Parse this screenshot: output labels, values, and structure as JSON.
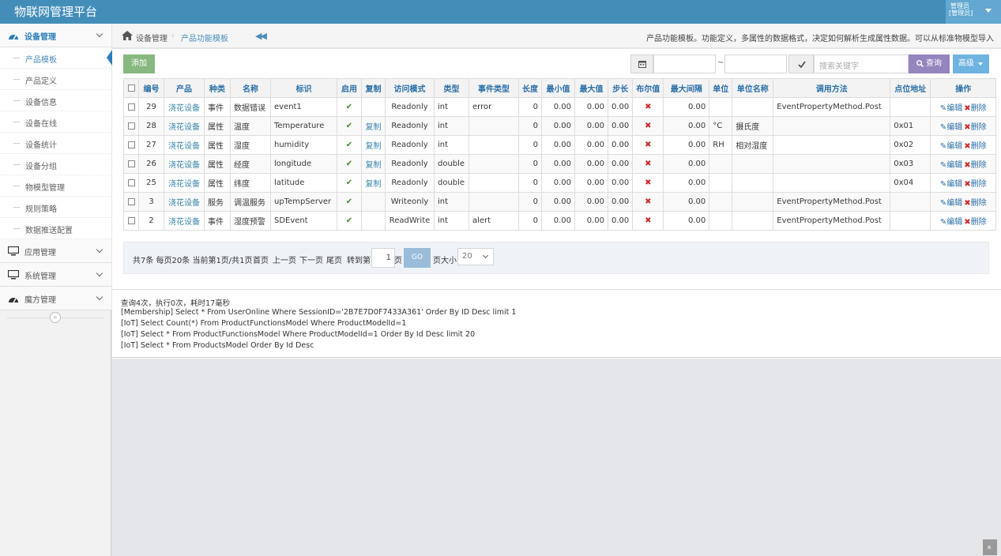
{
  "app": {
    "title": "物联网管理平台"
  },
  "user": {
    "line1": "管理员",
    "line2": "[管理员]"
  },
  "sidebar": {
    "groups": [
      {
        "label": "设备管理",
        "icon": "dashboard-icon"
      },
      {
        "label": "应用管理",
        "icon": "desktop-icon"
      },
      {
        "label": "系统管理",
        "icon": "desktop-icon"
      },
      {
        "label": "魔方管理",
        "icon": "dashboard-icon"
      }
    ],
    "subitems": [
      "产品模板",
      "产品定义",
      "设备信息",
      "设备在线",
      "设备统计",
      "设备分组",
      "物模型管理",
      "规则策略",
      "数据推送配置"
    ],
    "collapse": "«"
  },
  "breadcrumb": {
    "root": "设备管理",
    "sep": "›",
    "current": "产品功能模板",
    "back": "◀◀",
    "description": "产品功能模板。功能定义，多属性的数据格式，决定如何解析生成属性数据。可以从标准物模型导入"
  },
  "toolbar": {
    "add": "添加",
    "tilde": "~",
    "search_placeholder": "搜索关键字",
    "query": "查询",
    "advanced": "高级"
  },
  "table": {
    "headers": [
      "编号",
      "产品",
      "种类",
      "名称",
      "标识",
      "启用",
      "复制",
      "访问模式",
      "类型",
      "事件类型",
      "长度",
      "最小值",
      "最大值",
      "步长",
      "布尔值",
      "最大间隔",
      "单位",
      "单位名称",
      "调用方法",
      "点位地址",
      "操作"
    ],
    "rows": [
      {
        "id": "29",
        "product": "浇花设备",
        "kind": "事件",
        "name": "数据错误",
        "ident": "event1",
        "copy": "",
        "access": "Readonly",
        "type": "int",
        "event_type": "error",
        "length": "0",
        "min": "0.00",
        "max": "0.00",
        "step": "0.00",
        "interval": "0.00",
        "unit": "",
        "unit_name": "",
        "method": "EventPropertyMethod.Post",
        "addr": ""
      },
      {
        "id": "28",
        "product": "浇花设备",
        "kind": "属性",
        "name": "温度",
        "ident": "Temperature",
        "copy": "复制",
        "access": "Readonly",
        "type": "int",
        "event_type": "",
        "length": "0",
        "min": "0.00",
        "max": "0.00",
        "step": "0.00",
        "interval": "0.00",
        "unit": "°C",
        "unit_name": "摄氏度",
        "method": "",
        "addr": "0x01"
      },
      {
        "id": "27",
        "product": "浇花设备",
        "kind": "属性",
        "name": "湿度",
        "ident": "humidity",
        "copy": "复制",
        "access": "Readonly",
        "type": "int",
        "event_type": "",
        "length": "0",
        "min": "0.00",
        "max": "0.00",
        "step": "0.00",
        "interval": "0.00",
        "unit": "RH",
        "unit_name": "相对湿度",
        "method": "",
        "addr": "0x02"
      },
      {
        "id": "26",
        "product": "浇花设备",
        "kind": "属性",
        "name": "经度",
        "ident": "longitude",
        "copy": "复制",
        "access": "Readonly",
        "type": "double",
        "event_type": "",
        "length": "0",
        "min": "0.00",
        "max": "0.00",
        "step": "0.00",
        "interval": "0.00",
        "unit": "",
        "unit_name": "",
        "method": "",
        "addr": "0x03"
      },
      {
        "id": "25",
        "product": "浇花设备",
        "kind": "属性",
        "name": "纬度",
        "ident": "latitude",
        "copy": "复制",
        "access": "Readonly",
        "type": "double",
        "event_type": "",
        "length": "0",
        "min": "0.00",
        "max": "0.00",
        "step": "0.00",
        "interval": "0.00",
        "unit": "",
        "unit_name": "",
        "method": "",
        "addr": "0x04"
      },
      {
        "id": "3",
        "product": "浇花设备",
        "kind": "服务",
        "name": "调温服务",
        "ident": "upTempServer",
        "copy": "",
        "access": "Writeonly",
        "type": "int",
        "event_type": "",
        "length": "0",
        "min": "0.00",
        "max": "0.00",
        "step": "0.00",
        "interval": "0.00",
        "unit": "",
        "unit_name": "",
        "method": "EventPropertyMethod.Post",
        "addr": ""
      },
      {
        "id": "2",
        "product": "浇花设备",
        "kind": "事件",
        "name": "湿度预警",
        "ident": "SDEvent",
        "copy": "",
        "access": "ReadWrite",
        "type": "int",
        "event_type": "alert",
        "length": "0",
        "min": "0.00",
        "max": "0.00",
        "step": "0.00",
        "interval": "0.00",
        "unit": "",
        "unit_name": "",
        "method": "EventPropertyMethod.Post",
        "addr": ""
      }
    ],
    "enabled_mark": "✔",
    "bool_mark": "✖",
    "edit": "编辑",
    "delete": "删除"
  },
  "pager": {
    "summary": "共7条 每页20条 当前第1页/共1页",
    "first": "首页",
    "prev": "上一页",
    "next": "下一页",
    "last": "尾页",
    "goto": "转到第",
    "page_value": "1",
    "page_unit": "页",
    "go": "GO",
    "size_label": "页大小",
    "size_value": "20"
  },
  "log": {
    "lines": [
      "查询4次，执行0次，耗时17毫秒",
      "[Membership] Select * From UserOnline Where SessionID='2B7E7D0F7433A361' Order By ID Desc limit 1",
      "[IoT] Select Count(*) From ProductFunctionsModel Where ProductModelId=1",
      "[IoT] Select * From ProductFunctionsModel Where ProductModelId=1 Order By Id Desc limit 20",
      "[IoT] Select * From ProductsModel Order By Id Desc"
    ]
  },
  "scroll_top": "»",
  "colors": {
    "navbar": "#438eb9",
    "add": "#87b87f",
    "query": "#9585bf",
    "advanced": "#6fb3e0",
    "link": "#3a87ad"
  }
}
